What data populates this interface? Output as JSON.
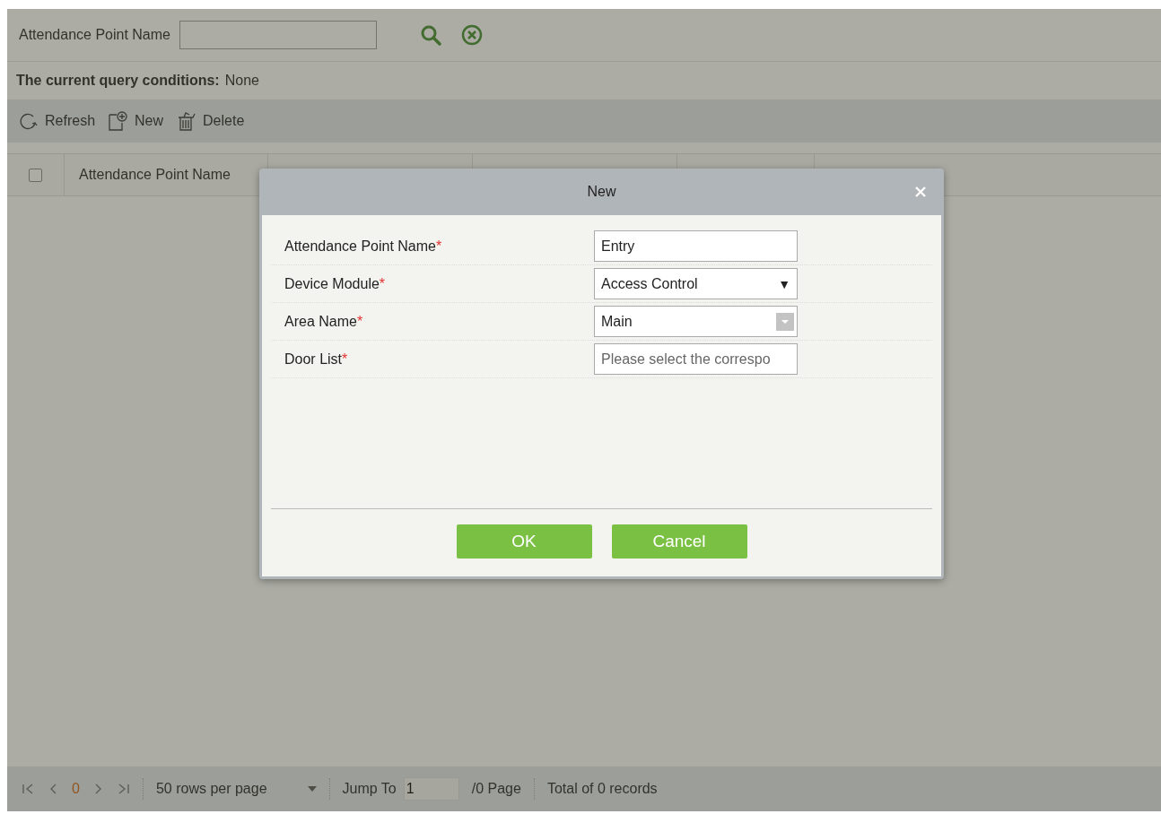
{
  "search": {
    "label": "Attendance Point Name"
  },
  "query": {
    "label": "The current query conditions:",
    "value": "None"
  },
  "toolbar": [
    {
      "label": "Refresh",
      "kind": "refresh"
    },
    {
      "label": "New",
      "kind": "new"
    },
    {
      "label": "Delete",
      "kind": "delete"
    }
  ],
  "table": {
    "select_all": {
      "checked": false
    },
    "columns": [
      "Attendance Point Name"
    ]
  },
  "dialog": {
    "title": "New",
    "fields": [
      {
        "label": "Attendance Point Name",
        "required_mark": "*",
        "kind": "text",
        "value": "Entry"
      },
      {
        "label": "Device Module",
        "required_mark": "*",
        "kind": "select",
        "value": "Access Control",
        "caret": "▼"
      },
      {
        "label": "Area Name",
        "required_mark": "*",
        "kind": "combo",
        "value": "Main"
      },
      {
        "label": "Door List",
        "required_mark": "*",
        "kind": "text",
        "placeholder": "Please select the correspo"
      }
    ],
    "buttons": [
      "OK",
      "Cancel"
    ]
  },
  "pager": {
    "current_page": "0",
    "rows_per_page": "50 rows per page",
    "jump_label": "Jump To",
    "jump_value": "1",
    "page_count": "/0 Page",
    "total": "Total of 0 records"
  }
}
